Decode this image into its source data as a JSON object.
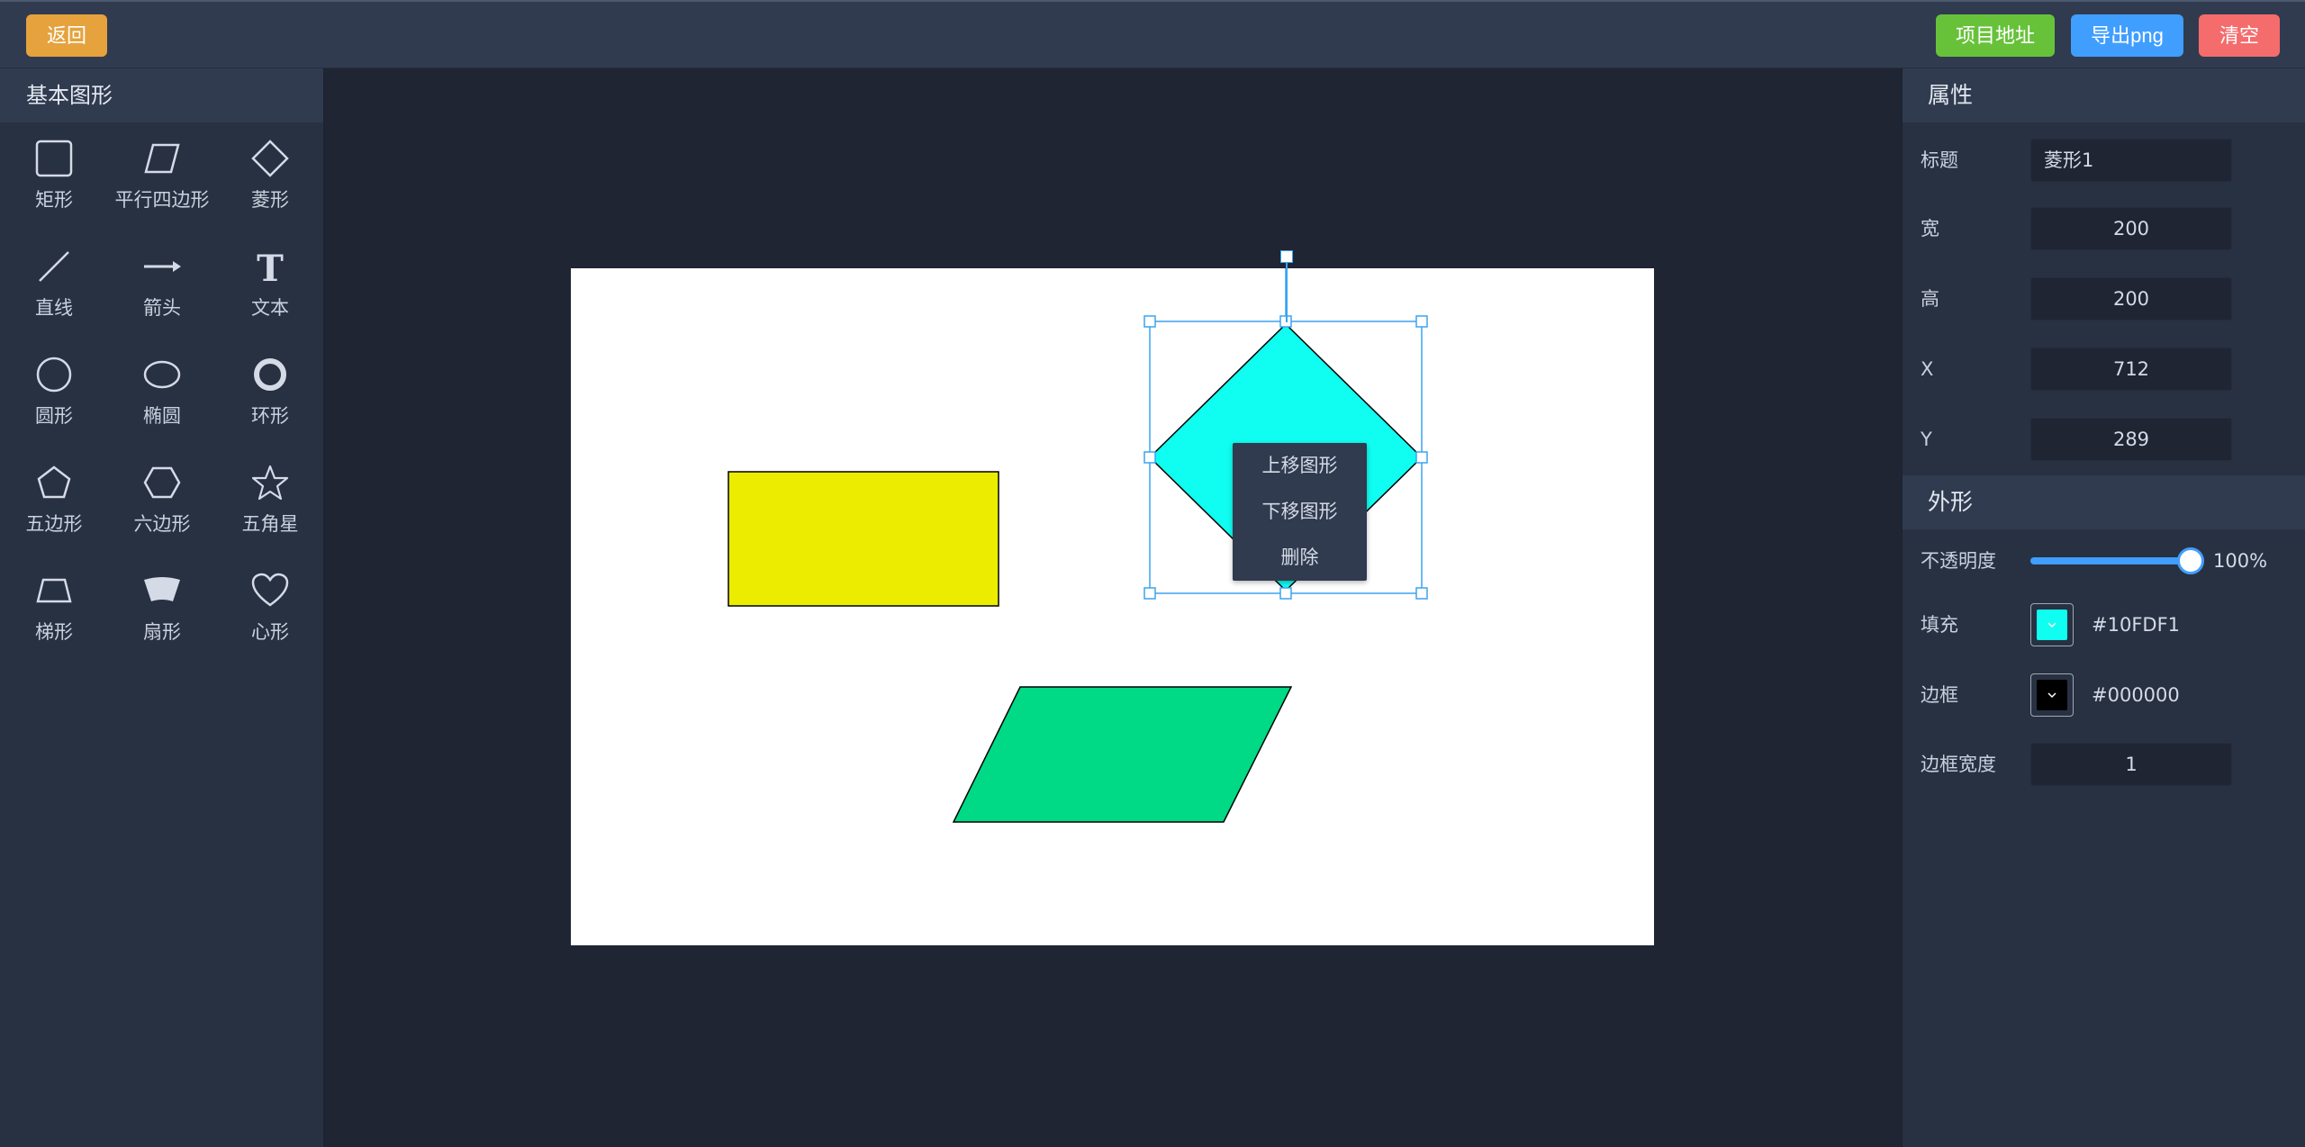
{
  "topbar": {
    "back_label": "返回",
    "repo_label": "项目地址",
    "export_label": "导出png",
    "clear_label": "清空"
  },
  "left_panel": {
    "title": "基本图形",
    "shapes": [
      {
        "label": "矩形",
        "icon": "rectangle-icon"
      },
      {
        "label": "平行四边形",
        "icon": "parallelogram-icon"
      },
      {
        "label": "菱形",
        "icon": "diamond-icon"
      },
      {
        "label": "直线",
        "icon": "line-icon"
      },
      {
        "label": "箭头",
        "icon": "arrow-icon"
      },
      {
        "label": "文本",
        "icon": "text-icon"
      },
      {
        "label": "圆形",
        "icon": "circle-icon"
      },
      {
        "label": "椭圆",
        "icon": "ellipse-icon"
      },
      {
        "label": "环形",
        "icon": "ring-icon"
      },
      {
        "label": "五边形",
        "icon": "pentagon-icon"
      },
      {
        "label": "六边形",
        "icon": "hexagon-icon"
      },
      {
        "label": "五角星",
        "icon": "star-icon"
      },
      {
        "label": "梯形",
        "icon": "trapezoid-icon"
      },
      {
        "label": "扇形",
        "icon": "sector-icon"
      },
      {
        "label": "心形",
        "icon": "heart-icon"
      }
    ]
  },
  "properties": {
    "section_title": "属性",
    "title_label": "标题",
    "title_value": "菱形1",
    "width_label": "宽",
    "width_value": "200",
    "height_label": "高",
    "height_value": "200",
    "x_label": "X",
    "x_value": "712",
    "y_label": "Y",
    "y_value": "289"
  },
  "appearance": {
    "section_title": "外形",
    "opacity_label": "不透明度",
    "opacity_value": "100%",
    "fill_label": "填充",
    "fill_value": "#10FDF1",
    "border_label": "边框",
    "border_value": "#000000",
    "border_width_label": "边框宽度",
    "border_width_value": "1"
  },
  "canvas": {
    "shapes": [
      {
        "name": "rectangle",
        "fill": "#ECEC00",
        "stroke": "#000000"
      },
      {
        "name": "diamond",
        "fill": "#10FDF1",
        "stroke": "#000000",
        "selected": true
      },
      {
        "name": "parallelogram",
        "fill": "#00D985",
        "stroke": "#000000"
      }
    ],
    "selection_color": "#3BA3F1"
  },
  "context_menu": {
    "items": [
      "上移图形",
      "下移图形",
      "删除"
    ]
  }
}
